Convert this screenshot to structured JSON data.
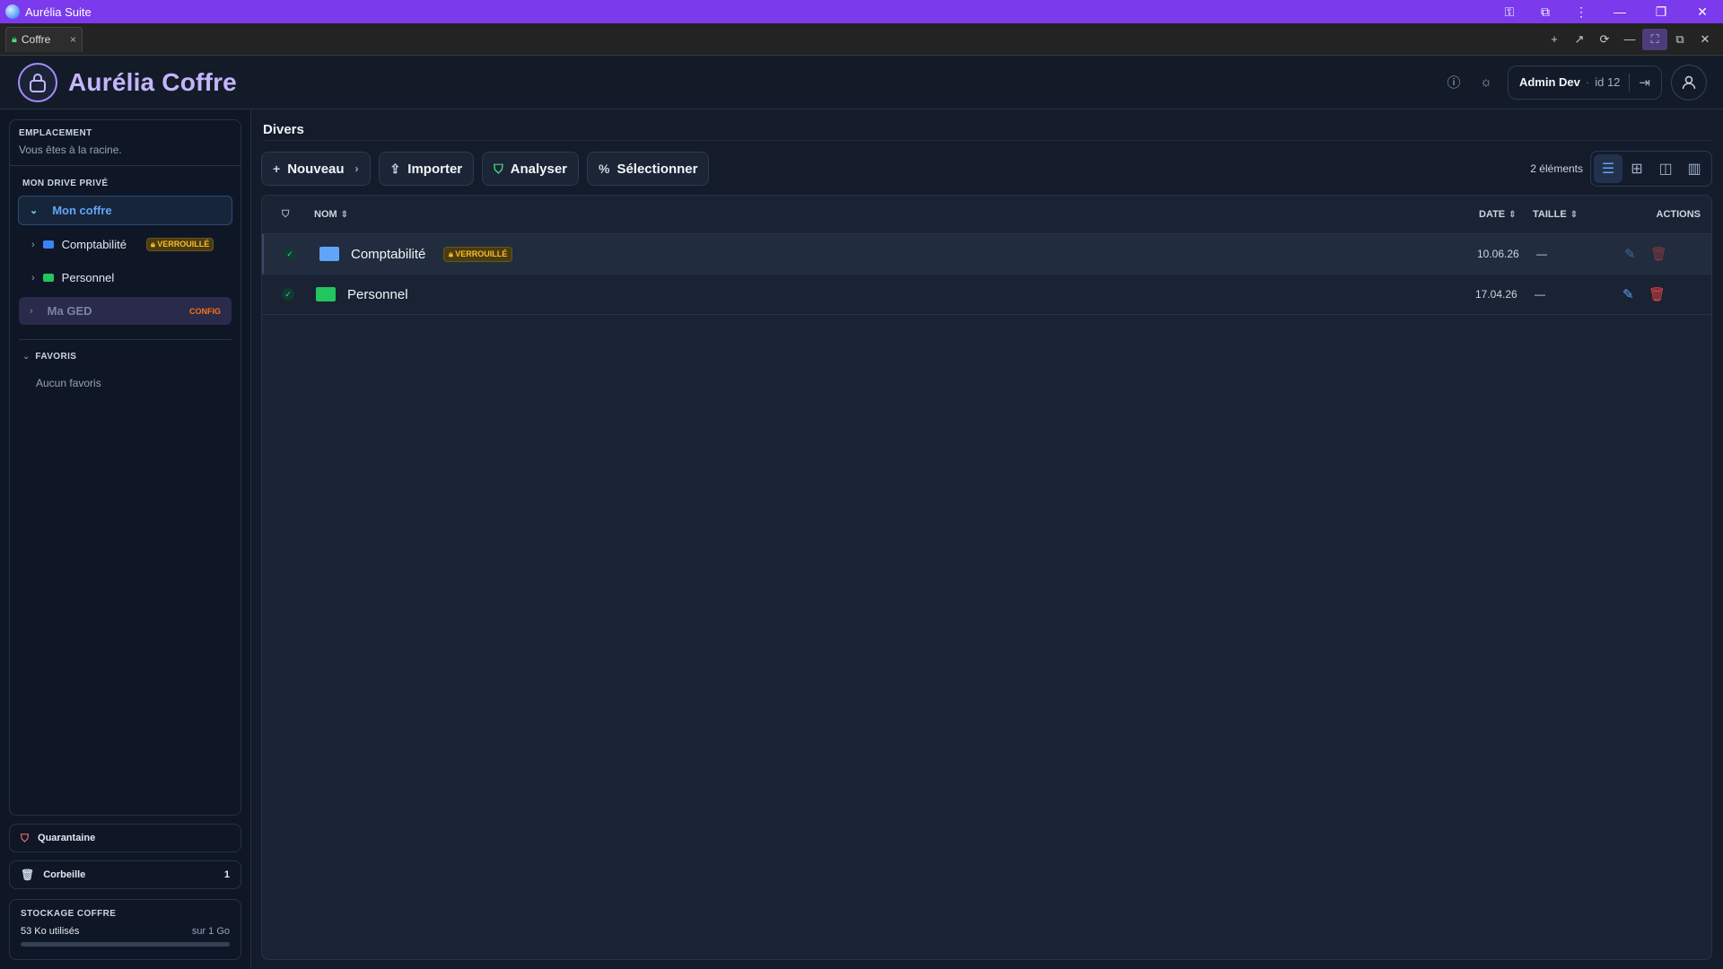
{
  "window": {
    "title": "Aurélia Suite"
  },
  "tab": {
    "label": "Coffre",
    "close": "×"
  },
  "brand": {
    "title": "Aurélia Coffre",
    "accent": "#c4b5fd"
  },
  "user": {
    "name": "Admin Dev",
    "separator": "·",
    "id_label": "id 12"
  },
  "sidebar": {
    "location_label": "EMPLACEMENT",
    "location_text": "Vous êtes à la racine.",
    "drive_label": "MON DRIVE PRIVÉ",
    "root": "Mon coffre",
    "items": [
      {
        "label": "Comptabilité",
        "badge": "VERROUILLÉ",
        "color": "#3b82f6"
      },
      {
        "label": "Personnel",
        "color": "#22c55e"
      }
    ],
    "ged": {
      "label": "Ma GED",
      "badge": "CONFIG"
    },
    "favorites_label": "FAVORIS",
    "favorites_empty": "Aucun favoris",
    "quarantine": "Quarantaine",
    "trash": {
      "label": "Corbeille",
      "count": "1"
    },
    "storage": {
      "label": "STOCKAGE COFFRE",
      "used": "53 Ko utilisés",
      "total": "sur 1 Go",
      "fraction": 5e-05
    }
  },
  "main": {
    "title": "Divers",
    "toolbar": {
      "new": "Nouveau",
      "import": "Importer",
      "analyze": "Analyser",
      "select": "Sélectionner",
      "count": "2 éléments"
    },
    "columns": {
      "name": "NOM",
      "date": "DATE",
      "size": "TAILLE",
      "actions": "ACTIONS"
    },
    "rows": [
      {
        "name": "Comptabilité",
        "badge": "VERROUILLÉ",
        "date": "10.06.26",
        "size": "—",
        "color": "#60a5fa"
      },
      {
        "name": "Personnel",
        "date": "17.04.26",
        "size": "—",
        "color": "#22c55e"
      }
    ]
  }
}
